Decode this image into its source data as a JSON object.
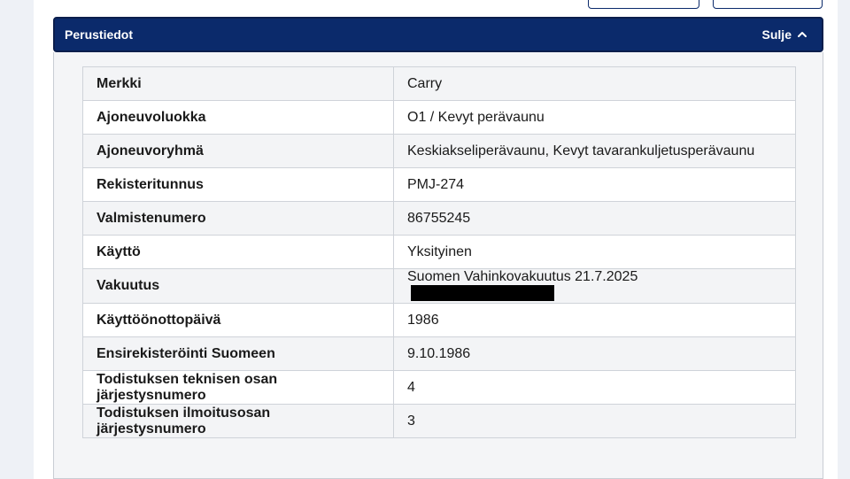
{
  "section": {
    "title": "Perustiedot",
    "toggle_label": "Sulje",
    "toggle_icon": "chevron-up-icon"
  },
  "rows": [
    {
      "label": "Merkki",
      "value": "Carry"
    },
    {
      "label": "Ajoneuvoluokka",
      "value": "O1 / Kevyt perävaunu"
    },
    {
      "label": "Ajoneuvoryhmä",
      "value": "Keskiakseliperävaunu, Kevyt tavarankuljetusperävaunu"
    },
    {
      "label": "Rekisteritunnus",
      "value": "PMJ-274"
    },
    {
      "label": "Valmistenumero",
      "value": "86755245"
    },
    {
      "label": "Käyttö",
      "value": "Yksityinen"
    },
    {
      "label": "Vakuutus",
      "value": "Suomen Vahinkovakuutus 21.7.2025"
    },
    {
      "label": "Käyttöönottopäivä",
      "value": "1986"
    },
    {
      "label": "Ensirekisteröinti Suomeen",
      "value": "9.10.1986"
    },
    {
      "label": "Todistuksen teknisen osan järjestysnumero",
      "value": "4"
    },
    {
      "label": "Todistuksen ilmoitusosan järjestysnumero",
      "value": "3"
    }
  ],
  "colors": {
    "header_bg": "#0b2a6b",
    "header_text": "#ffffff",
    "redaction": "#000000"
  }
}
